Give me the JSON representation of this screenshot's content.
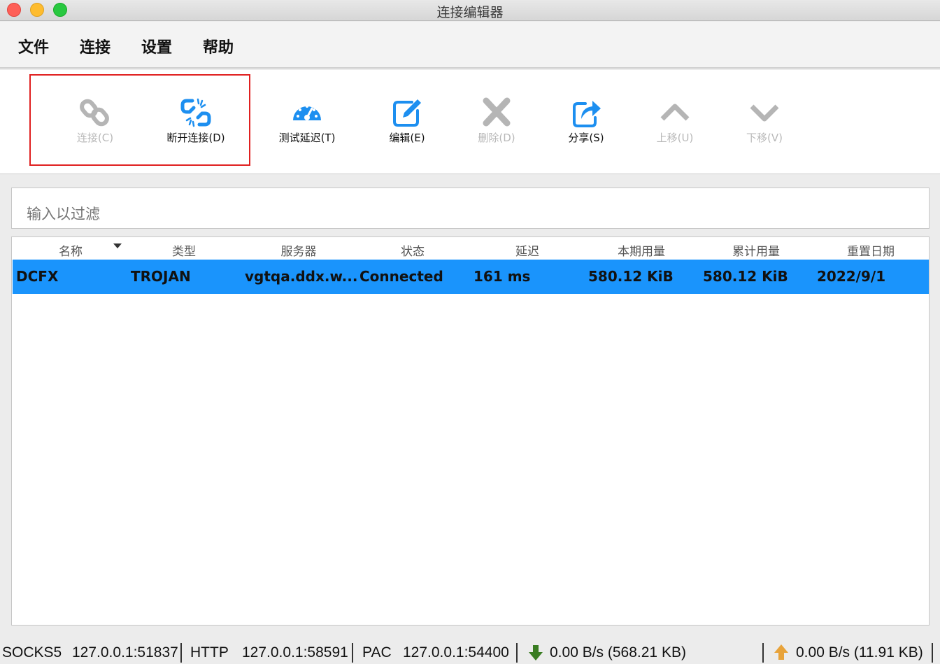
{
  "window": {
    "title": "连接编辑器"
  },
  "menu": {
    "file": "文件",
    "connect": "连接",
    "settings": "设置",
    "help": "帮助"
  },
  "toolbar": {
    "connect": "连接(C)",
    "disconnect": "断开连接(D)",
    "test_latency": "测试延迟(T)",
    "edit": "编辑(E)",
    "delete": "删除(D)",
    "share": "分享(S)",
    "move_up": "上移(U)",
    "move_down": "下移(V)"
  },
  "filter": {
    "placeholder": "输入以过滤"
  },
  "table": {
    "headers": [
      "名称",
      "类型",
      "服务器",
      "状态",
      "延迟",
      "本期用量",
      "累计用量",
      "重置日期"
    ],
    "rows": [
      [
        "DCFX",
        "TROJAN",
        "vgtqa.ddx.w...",
        "Connected",
        "161 ms",
        "580.12  KiB",
        "580.12  KiB",
        "2022/9/1"
      ]
    ]
  },
  "status": {
    "socks_label": "SOCKS5",
    "socks_addr": "127.0.0.1:51837",
    "http_label": "HTTP",
    "http_addr": "127.0.0.1:58591",
    "pac_label": "PAC",
    "pac_addr": "127.0.0.1:54400",
    "download": "0.00 B/s (568.21 KB)",
    "upload": "0.00 B/s (11.91 KB)"
  },
  "colors": {
    "selection": "#1a94fc",
    "accent_icon": "#1d8ff0",
    "disabled_icon": "#b5b5b5",
    "highlight_border": "#e02020",
    "download_arrow": "#3a7d22",
    "upload_arrow": "#e8a33a"
  },
  "icons": {
    "connect": "link-icon",
    "disconnect": "broken-link-icon",
    "test_latency": "speedometer-icon",
    "edit": "edit-icon",
    "delete": "x-icon",
    "share": "share-icon",
    "move_up": "chevron-up-icon",
    "move_down": "chevron-down-icon"
  }
}
